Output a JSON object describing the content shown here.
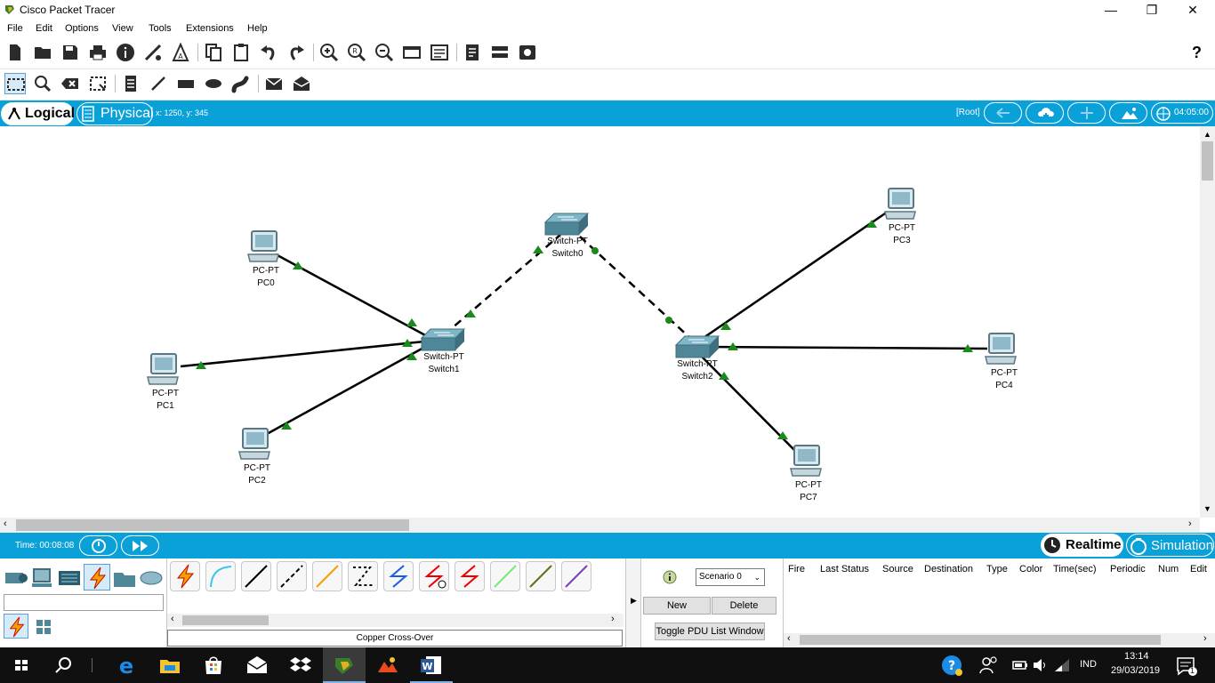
{
  "window": {
    "title": "Cisco Packet Tracer",
    "min_glyph": "—",
    "max_glyph": "❐",
    "close_glyph": "✕"
  },
  "menu": [
    "File",
    "Edit",
    "Options",
    "View",
    "Tools",
    "Extensions",
    "Help"
  ],
  "main_toolbar_help": "?",
  "tabs": {
    "logical": "Logical",
    "physical": "Physical"
  },
  "coords": "x: 1250, y: 345",
  "root_label": "[Root]",
  "clock": "04:05:00",
  "devices": [
    {
      "type": "PC-PT",
      "name": "PC0"
    },
    {
      "type": "PC-PT",
      "name": "PC1"
    },
    {
      "type": "PC-PT",
      "name": "PC2"
    },
    {
      "type": "Switch-PT",
      "name": "Switch1"
    },
    {
      "type": "Switch-PT",
      "name": "Switch0"
    },
    {
      "type": "Switch-PT",
      "name": "Switch2"
    },
    {
      "type": "PC-PT",
      "name": "PC3"
    },
    {
      "type": "PC-PT",
      "name": "PC4"
    },
    {
      "type": "PC-PT",
      "name": "PC7"
    }
  ],
  "time_label": "Time: 00:08:08",
  "mode": {
    "realtime": "Realtime",
    "simulation": "Simulation"
  },
  "selected_cable": "Copper Cross-Over",
  "scenario": {
    "selected": "Scenario 0",
    "new": "New",
    "delete": "Delete",
    "toggle": "Toggle PDU List Window"
  },
  "pdu_columns": [
    "Fire",
    "Last Status",
    "Source",
    "Destination",
    "Type",
    "Color",
    "Time(sec)",
    "Periodic",
    "Num",
    "Edit"
  ],
  "taskbar": {
    "lang": "IND",
    "time": "13:14",
    "date": "29/03/2019",
    "notif_count": "1"
  },
  "colors": {
    "accent": "#0aa0d8",
    "link_up": "#1a8a1a",
    "cable": "#000000"
  }
}
